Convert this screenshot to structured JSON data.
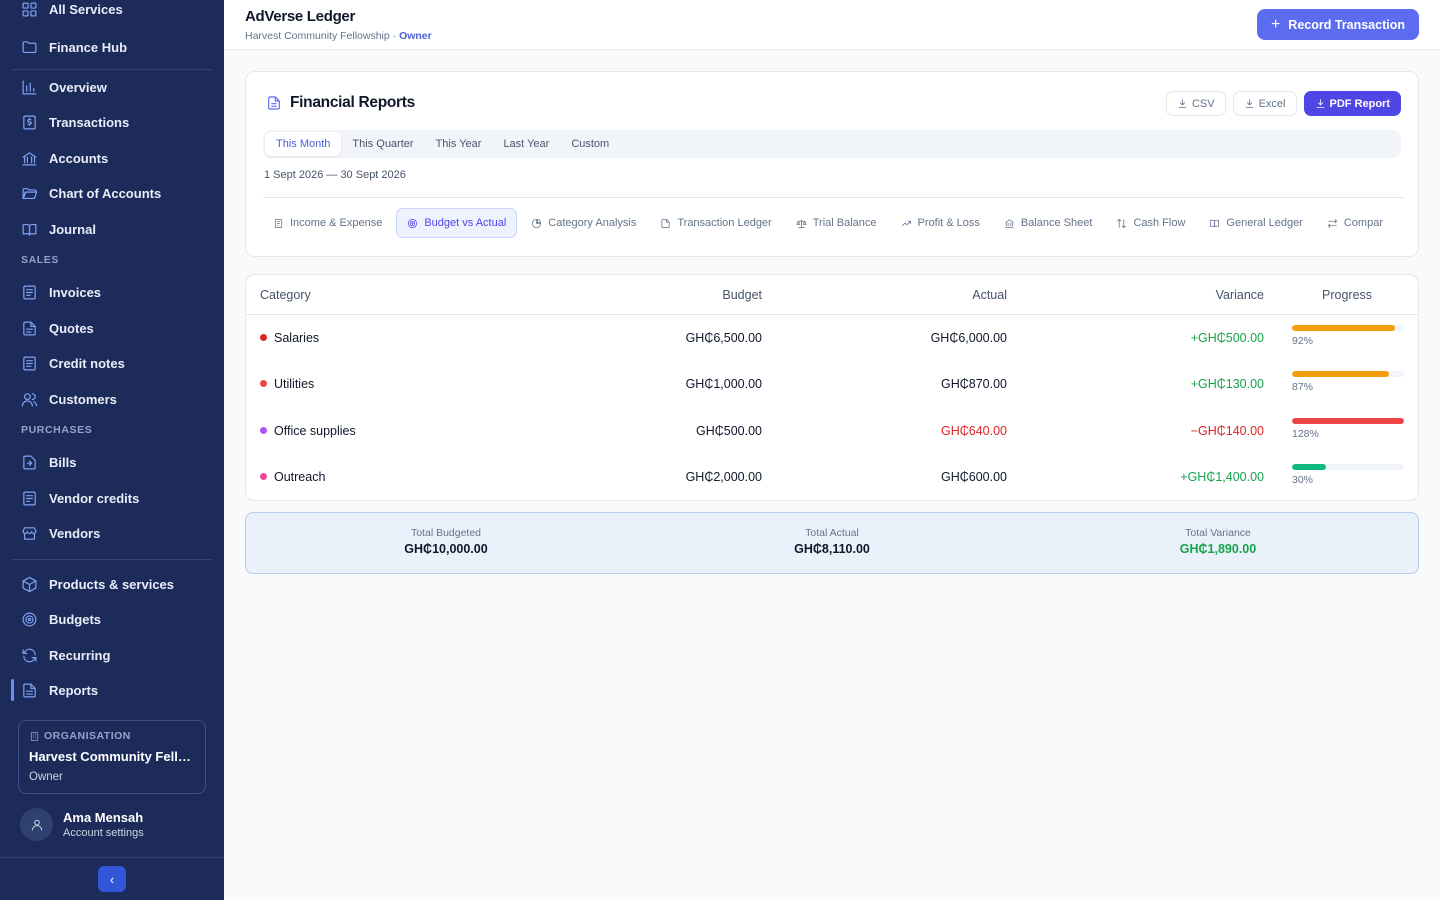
{
  "sidebar": {
    "items": [
      {
        "key": "all-services",
        "label": "All Services",
        "icon": "grid-icon"
      },
      {
        "key": "finance-hub",
        "label": "Finance Hub",
        "icon": "folder-icon"
      },
      {
        "key": "overview",
        "label": "Overview",
        "icon": "bar-chart-icon"
      },
      {
        "key": "transactions",
        "label": "Transactions",
        "icon": "dollar-icon"
      },
      {
        "key": "accounts",
        "label": "Accounts",
        "icon": "bank-icon"
      },
      {
        "key": "chart-of-accounts",
        "label": "Chart of Accounts",
        "icon": "folder-open-icon"
      },
      {
        "key": "journal",
        "label": "Journal",
        "icon": "book-icon"
      },
      {
        "key": "invoices",
        "label": "Invoices",
        "icon": "invoice-icon"
      },
      {
        "key": "quotes",
        "label": "Quotes",
        "icon": "document-icon"
      },
      {
        "key": "credit-notes",
        "label": "Credit notes",
        "icon": "note-icon"
      },
      {
        "key": "customers",
        "label": "Customers",
        "icon": "users-icon"
      },
      {
        "key": "bills",
        "label": "Bills",
        "icon": "bill-icon"
      },
      {
        "key": "vendor-credits",
        "label": "Vendor credits",
        "icon": "receipt-icon"
      },
      {
        "key": "vendors",
        "label": "Vendors",
        "icon": "store-icon"
      },
      {
        "key": "products-services",
        "label": "Products & services",
        "icon": "box-icon"
      },
      {
        "key": "budgets",
        "label": "Budgets",
        "icon": "target-icon"
      },
      {
        "key": "recurring",
        "label": "Recurring",
        "icon": "refresh-icon"
      },
      {
        "key": "reports",
        "label": "Reports",
        "icon": "report-icon"
      }
    ],
    "sections": {
      "sales": "SALES",
      "purchases": "PURCHASES"
    },
    "organisation": {
      "label": "ORGANISATION",
      "name": "Harvest Community Fello...",
      "role": "Owner"
    },
    "user": {
      "name": "Ama Mensah",
      "sub": "Account settings"
    },
    "collapse_glyph": "‹"
  },
  "header": {
    "title": "AdVerse Ledger",
    "org": "Harvest Community Fellowship",
    "separator": " · ",
    "role": "Owner",
    "record_button": "Record Transaction"
  },
  "reports": {
    "title": "Financial Reports",
    "export": {
      "csv": "CSV",
      "excel": "Excel",
      "pdf": "PDF Report"
    },
    "periods": [
      "This Month",
      "This Quarter",
      "This Year",
      "Last Year",
      "Custom"
    ],
    "active_period": "This Month",
    "date_range": "1 Sept 2026 — 30 Sept 2026",
    "tabs": [
      {
        "label": "Income & Expense",
        "icon": "receipt-icon"
      },
      {
        "label": "Budget vs Actual",
        "icon": "target-icon"
      },
      {
        "label": "Category Analysis",
        "icon": "pie-chart-icon"
      },
      {
        "label": "Transaction Ledger",
        "icon": "document-icon"
      },
      {
        "label": "Trial Balance",
        "icon": "scale-icon"
      },
      {
        "label": "Profit & Loss",
        "icon": "trend-icon"
      },
      {
        "label": "Balance Sheet",
        "icon": "bank-icon"
      },
      {
        "label": "Cash Flow",
        "icon": "arrows-updown-icon"
      },
      {
        "label": "General Ledger",
        "icon": "book-icon"
      },
      {
        "label": "Compar",
        "icon": "arrows-leftright-icon"
      }
    ],
    "active_tab": "Budget vs Actual"
  },
  "table": {
    "headers": {
      "category": "Category",
      "budget": "Budget",
      "actual": "Actual",
      "variance": "Variance",
      "progress": "Progress"
    },
    "rows": [
      {
        "category": "Salaries",
        "dot_color": "#dc2626",
        "budget": "GH₵6,500.00",
        "actual": "GH₵6,000.00",
        "actual_over": false,
        "variance": "+GH₵500.00",
        "variance_negative": false,
        "progress": 92,
        "progress_label": "92%",
        "bar_color": "#f59e0b"
      },
      {
        "category": "Utilities",
        "dot_color": "#ef4444",
        "budget": "GH₵1,000.00",
        "actual": "GH₵870.00",
        "actual_over": false,
        "variance": "+GH₵130.00",
        "variance_negative": false,
        "progress": 87,
        "progress_label": "87%",
        "bar_color": "#f59e0b"
      },
      {
        "category": "Office supplies",
        "dot_color": "#a855f7",
        "budget": "GH₵500.00",
        "actual": "GH₵640.00",
        "actual_over": true,
        "variance": "−GH₵140.00",
        "variance_negative": true,
        "progress": 100,
        "progress_label": "128%",
        "bar_color": "#ef4444"
      },
      {
        "category": "Outreach",
        "dot_color": "#ec4899",
        "budget": "GH₵2,000.00",
        "actual": "GH₵600.00",
        "actual_over": false,
        "variance": "+GH₵1,400.00",
        "variance_negative": false,
        "progress": 30,
        "progress_label": "30%",
        "bar_color": "#10b981"
      }
    ]
  },
  "summary": {
    "budgeted_label": "Total Budgeted",
    "budgeted": "GH₵10,000.00",
    "actual_label": "Total Actual",
    "actual": "GH₵8,110.00",
    "variance_label": "Total Variance",
    "variance": "GH₵1,890.00"
  }
}
